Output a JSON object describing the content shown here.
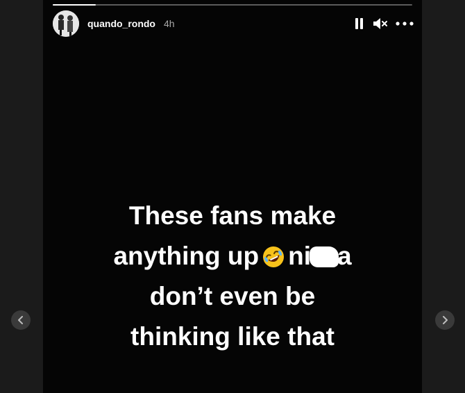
{
  "story": {
    "username": "quando_rondo",
    "time_ago": "4h",
    "progress_fraction": 0.12,
    "caption_lines": [
      "These fans make",
      "anything up",
      "ni",
      "a",
      "don’t even be",
      "thinking like that"
    ],
    "emoji": "rolling-on-the-floor-laughing-emoji"
  },
  "controls": {
    "pause_icon": "pause-icon",
    "mute_icon": "muted-speaker-icon",
    "more_icon": "more-options-icon"
  },
  "navigation": {
    "prev_icon": "chevron-left-icon",
    "next_icon": "chevron-right-icon"
  },
  "colors": {
    "backdrop": "#1b1b1b",
    "story_background": "#050505",
    "text": "#ffffff",
    "meta_text": "#a8a8a8"
  }
}
